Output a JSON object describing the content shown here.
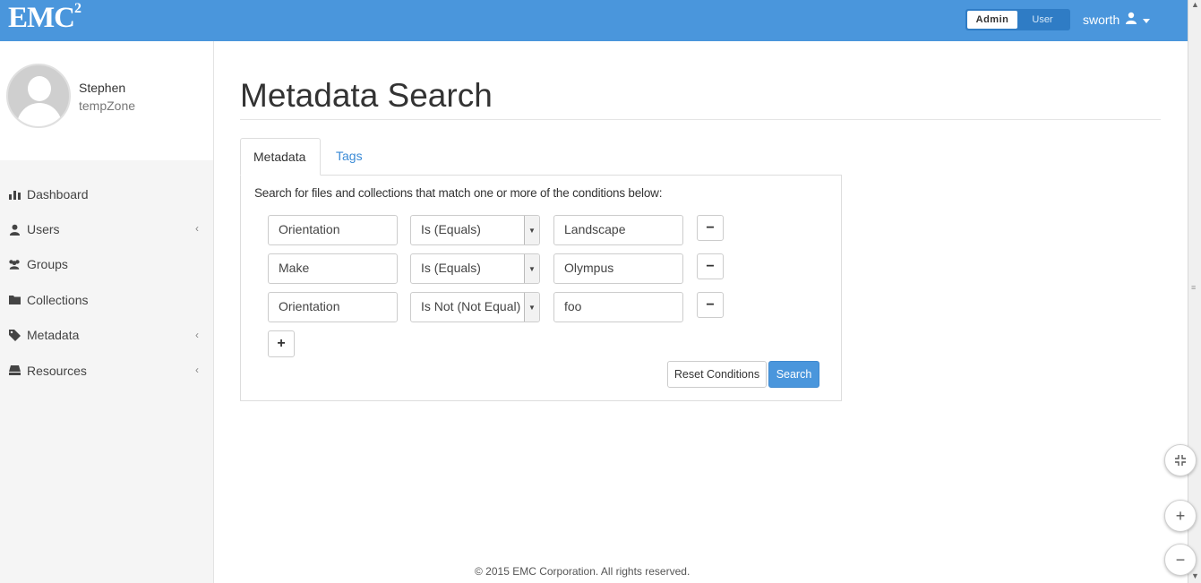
{
  "header": {
    "logo_text": "EMC",
    "logo_sup": "2",
    "role_toggle": {
      "admin_label": "Admin",
      "user_label": "User"
    },
    "username": "sworth"
  },
  "sidebar": {
    "profile": {
      "name": "Stephen",
      "zone": "tempZone"
    },
    "items": [
      {
        "label": "Dashboard",
        "icon": "bar-chart-icon",
        "has_submenu": false
      },
      {
        "label": "Users",
        "icon": "user-icon",
        "has_submenu": true
      },
      {
        "label": "Groups",
        "icon": "group-icon",
        "has_submenu": false
      },
      {
        "label": "Collections",
        "icon": "folder-icon",
        "has_submenu": false
      },
      {
        "label": "Metadata",
        "icon": "tag-icon",
        "has_submenu": true
      },
      {
        "label": "Resources",
        "icon": "drive-icon",
        "has_submenu": true
      }
    ]
  },
  "main": {
    "title": "Metadata Search",
    "tabs": [
      {
        "label": "Metadata",
        "active": true
      },
      {
        "label": "Tags",
        "active": false
      }
    ],
    "description": "Search for files and collections that match one or more of the conditions below:",
    "conditions": [
      {
        "attribute": "Orientation",
        "operator": "Is (Equals)",
        "value": "Landscape"
      },
      {
        "attribute": "Make",
        "operator": "Is (Equals)",
        "value": "Olympus"
      },
      {
        "attribute": "Orientation",
        "operator": "Is Not (Not Equal)",
        "value": "foo"
      }
    ],
    "add_label": "+",
    "remove_label": "−",
    "reset_label": "Reset Conditions",
    "search_label": "Search"
  },
  "footer": {
    "text": "© 2015 EMC Corporation. All rights reserved."
  },
  "window_controls": {
    "collapse_icon": "compress-icon",
    "zoom_in_label": "+",
    "zoom_out_label": "−"
  },
  "colors": {
    "primary": "#4a96dc",
    "sidebar_bg": "#f5f5f5",
    "link": "#3a8ad6"
  }
}
